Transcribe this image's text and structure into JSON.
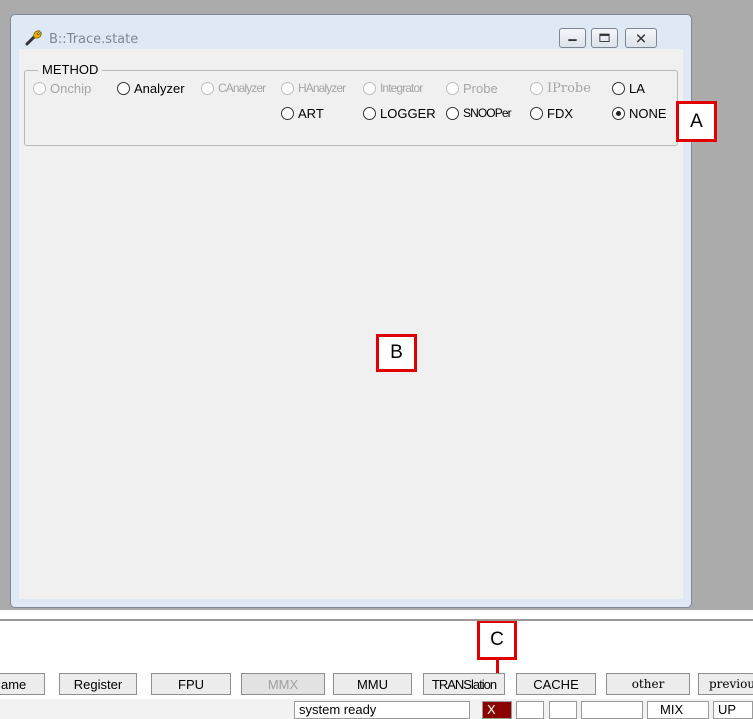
{
  "window": {
    "title": "B::Trace.state",
    "group_label": "METHOD",
    "radios_row1": [
      {
        "label": "Onchip",
        "state": "disabled"
      },
      {
        "label": "Analyzer",
        "state": "enabled"
      },
      {
        "label": "CAnalyzer",
        "state": "disabled"
      },
      {
        "label": "HAnalyzer",
        "state": "disabled"
      },
      {
        "label": "Integrator",
        "state": "disabled"
      },
      {
        "label": "Probe",
        "state": "disabled"
      },
      {
        "label": "IProbe",
        "state": "disabled"
      },
      {
        "label": "LA",
        "state": "enabled"
      }
    ],
    "radios_row2": [
      {
        "label": "ART",
        "state": "enabled"
      },
      {
        "label": "LOGGER",
        "state": "enabled"
      },
      {
        "label": "SNOOPer",
        "state": "enabled"
      },
      {
        "label": "FDX",
        "state": "enabled"
      },
      {
        "label": "NONE",
        "state": "checked"
      }
    ]
  },
  "callouts": {
    "a": "A",
    "b": "B",
    "c": "C"
  },
  "toolbar": {
    "buttons": [
      "ame",
      "Register",
      "FPU",
      "MMX",
      "MMU",
      "TRANSlation",
      "CACHE",
      "other",
      "previous"
    ]
  },
  "status": {
    "message": "system ready",
    "error_flag": "X",
    "mode": "MIX",
    "direction": "UP"
  },
  "colors": {
    "callout_border": "#e00000",
    "error_cell": "#8b0000"
  }
}
